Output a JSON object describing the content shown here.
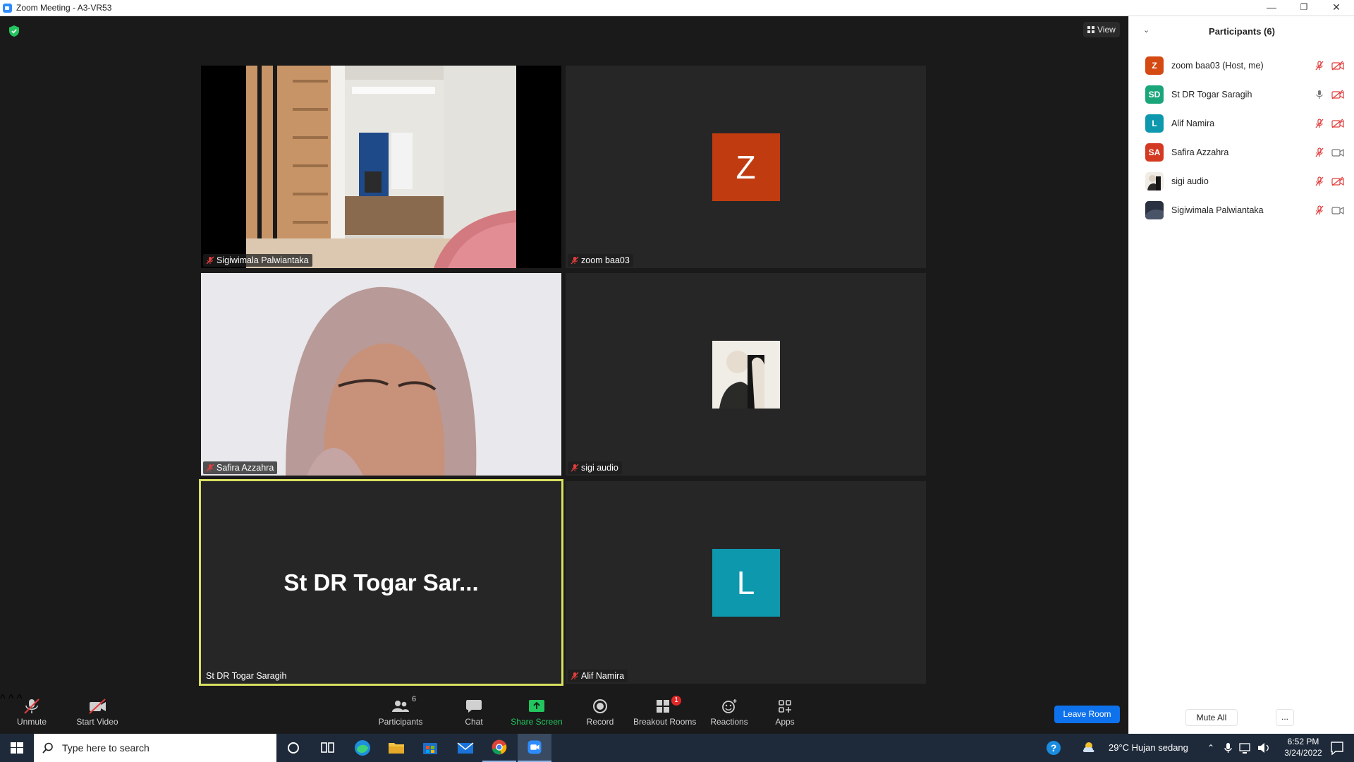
{
  "window": {
    "title": "Zoom Meeting - A3-VR53",
    "minimize": "—",
    "restore": "❐",
    "close": "✕"
  },
  "meeting": {
    "view_label": "View",
    "tiles": [
      {
        "name": "Sigiwimala Palwiantaka",
        "type": "video"
      },
      {
        "name": "zoom baa03",
        "type": "avatar",
        "initial": "Z",
        "color": "#c03c10"
      },
      {
        "name": "Safira Azzahra",
        "type": "video"
      },
      {
        "name": "sigi audio",
        "type": "photo"
      },
      {
        "name": "St DR Togar Saragih",
        "type": "name",
        "big_name": "St DR Togar Sar...",
        "active": true
      },
      {
        "name": "Alif Namira",
        "type": "avatar",
        "initial": "L",
        "color": "#0e98ae"
      }
    ]
  },
  "toolbar": {
    "unmute": "Unmute",
    "start_video": "Start Video",
    "participants": "Participants",
    "participants_count": "6",
    "chat": "Chat",
    "share_screen": "Share Screen",
    "record": "Record",
    "breakout_rooms": "Breakout Rooms",
    "breakout_badge": "1",
    "reactions": "Reactions",
    "apps": "Apps",
    "leave": "Leave Room",
    "caret": "^"
  },
  "panel": {
    "title": "Participants (6)",
    "participants": [
      {
        "name": "zoom baa03 (Host, me)",
        "initials": "Z",
        "color": "#d44a12",
        "mic": "muted",
        "cam": "off"
      },
      {
        "name": "St DR Togar Saragih",
        "initials": "SD",
        "color": "#1aa67a",
        "mic": "on",
        "cam": "off"
      },
      {
        "name": "Alif Namira",
        "initials": "L",
        "color": "#0e98ae",
        "mic": "muted",
        "cam": "off"
      },
      {
        "name": "Safira Azzahra",
        "initials": "SA",
        "color": "#d43a22",
        "mic": "muted",
        "cam": "on"
      },
      {
        "name": "sigi audio",
        "initials": "",
        "color": "#c8c2b8",
        "mic": "muted",
        "cam": "off"
      },
      {
        "name": "Sigiwimala Palwiantaka",
        "initials": "",
        "color": "#2c3340",
        "mic": "muted",
        "cam": "on"
      }
    ],
    "mute_all": "Mute All",
    "more": "..."
  },
  "taskbar": {
    "search_placeholder": "Type here to search",
    "weather": "29°C  Hujan sedang",
    "time": "6:52 PM",
    "date": "3/24/2022"
  }
}
